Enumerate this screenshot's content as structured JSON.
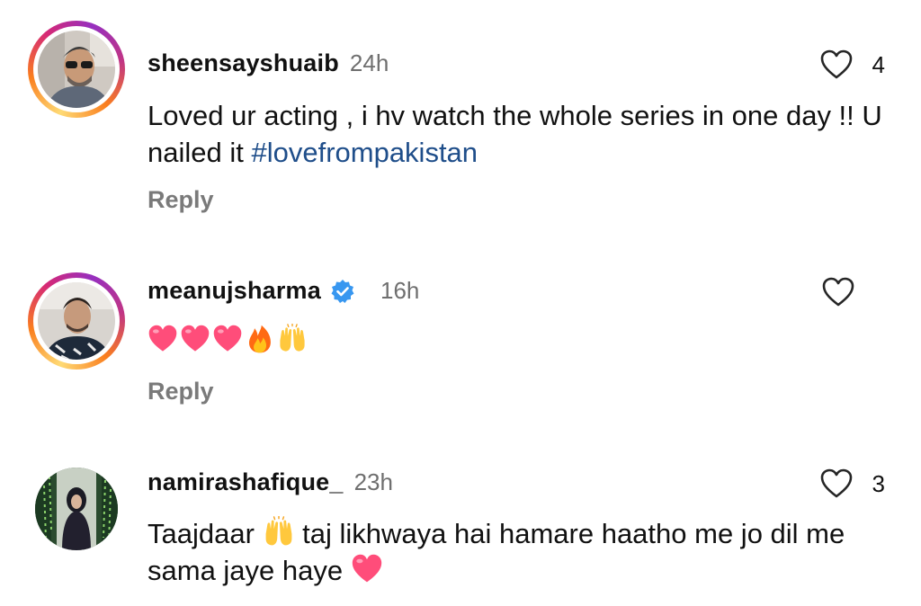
{
  "comments": [
    {
      "username": "sheensayshuaib",
      "time": "24h",
      "verified": false,
      "text": "Loved ur acting , i hv watch the whole series in one day !! U nailed it ",
      "hashtag": "#lovefrompakistan",
      "likes": "4",
      "reply_label": "Reply",
      "story_ring": true
    },
    {
      "username": "meanujsharma",
      "time": "16h",
      "verified": true,
      "emojis": [
        "pink-heart",
        "pink-heart",
        "pink-heart",
        "fire",
        "raising-hands"
      ],
      "likes": "",
      "reply_label": "Reply",
      "story_ring": true
    },
    {
      "username": "namirashafique_",
      "time": "23h",
      "verified": false,
      "text_part1": "Taajdaar ",
      "text_part2": " taj likhwaya hai hamare haatho me jo dil me sama jaye haye ",
      "likes": "3",
      "story_ring": false
    }
  ],
  "colors": {
    "hashtag": "#1f4e8a",
    "verified": "#3897f0",
    "muted": "#6f6f6f",
    "reply": "#7a7a7a",
    "heart_emoji": "#ff3b6b"
  }
}
